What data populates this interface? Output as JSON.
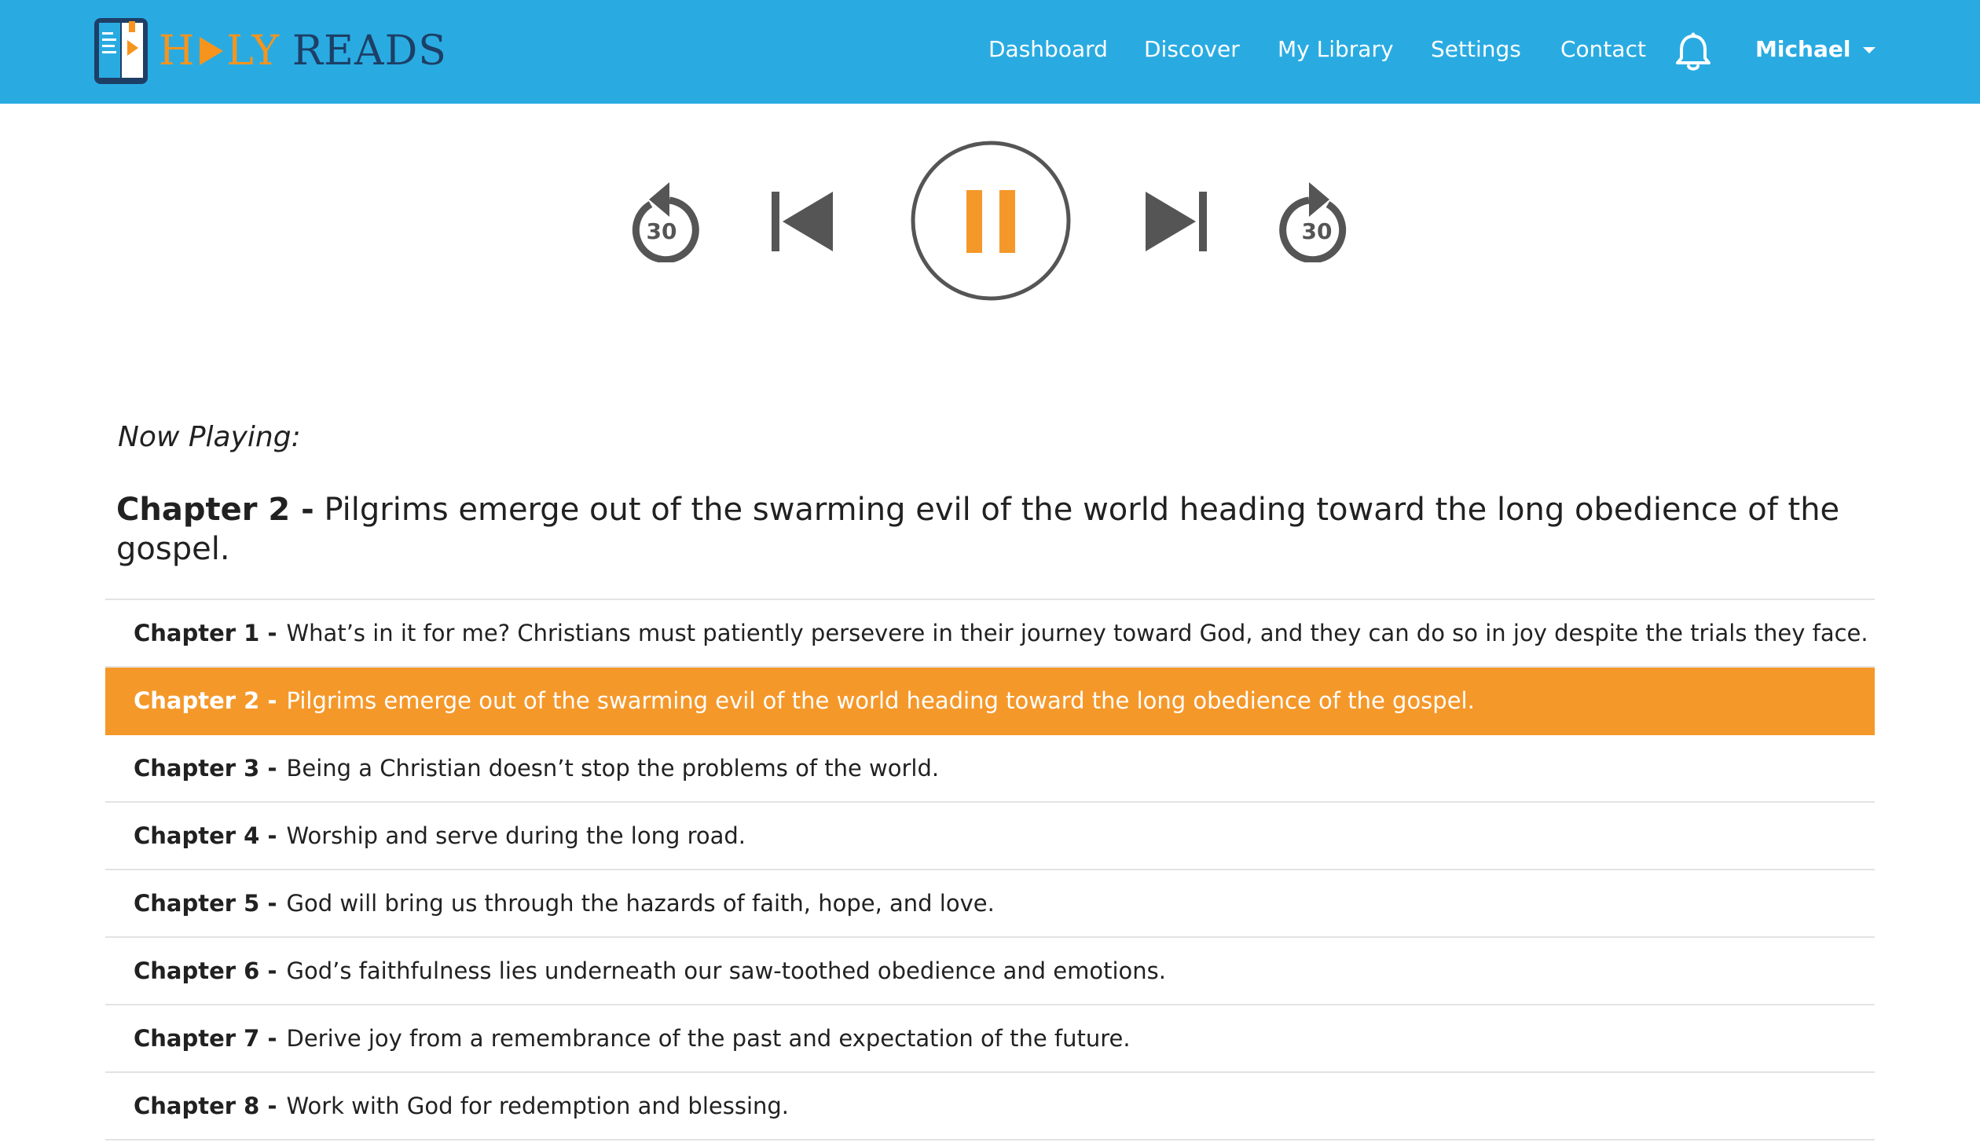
{
  "brand": {
    "name_part1": "H",
    "name_part2": "LY",
    "name_part3": "READS"
  },
  "nav": {
    "items": [
      {
        "label": "Dashboard"
      },
      {
        "label": "Discover"
      },
      {
        "label": "My Library"
      },
      {
        "label": "Settings"
      },
      {
        "label": "Contact"
      }
    ],
    "user": "Michael"
  },
  "player": {
    "skip_back_seconds": "30",
    "skip_forward_seconds": "30",
    "state": "playing"
  },
  "now_playing": {
    "label": "Now Playing:",
    "chapter": "Chapter 2 -",
    "title": "Pilgrims emerge out of the swarming evil of the world heading toward the long obedience of the gospel."
  },
  "chapters": [
    {
      "num": "Chapter 1 -",
      "title": "What’s in it for me? Christians must patiently persevere in their journey toward God, and they can do so in joy despite the trials they face."
    },
    {
      "num": "Chapter 2 -",
      "title": "Pilgrims emerge out of the swarming evil of the world heading toward the long obedience of the gospel."
    },
    {
      "num": "Chapter 3 -",
      "title": "Being a Christian doesn’t stop the problems of the world."
    },
    {
      "num": "Chapter 4 -",
      "title": "Worship and serve during the long road."
    },
    {
      "num": "Chapter 5 -",
      "title": "God will bring us through the hazards of faith, hope, and love."
    },
    {
      "num": "Chapter 6 -",
      "title": "God’s faithfulness lies underneath our saw-toothed obedience and emotions."
    },
    {
      "num": "Chapter 7 -",
      "title": "Derive joy from a remembrance of the past and expectation of the future."
    },
    {
      "num": "Chapter 8 -",
      "title": "Work with God for redemption and blessing."
    }
  ],
  "active_chapter_index": 1,
  "colors": {
    "navbar": "#29abe2",
    "accent": "#f5982a",
    "control_gray": "#555555"
  }
}
